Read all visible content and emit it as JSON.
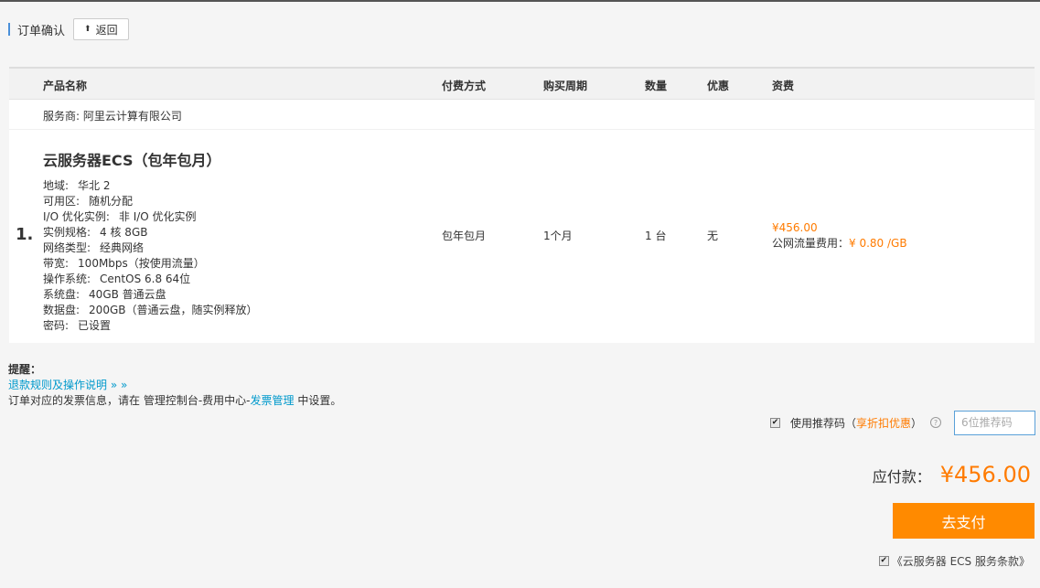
{
  "header": {
    "title": "订单确认",
    "back_label": "返回"
  },
  "table": {
    "columns": [
      "产品名称",
      "付费方式",
      "购买周期",
      "数量",
      "优惠",
      "资费"
    ],
    "vendor": "服务商: 阿里云计算有限公司",
    "item": {
      "index": "1.",
      "name": "云服务器ECS（包年包月）",
      "specs": [
        {
          "label": "地域:",
          "value": "华北 2"
        },
        {
          "label": "可用区:",
          "value": "随机分配"
        },
        {
          "label": "I/O 优化实例:",
          "value": "非 I/O 优化实例"
        },
        {
          "label": "实例规格:",
          "value": "4 核 8GB"
        },
        {
          "label": "网络类型:",
          "value": "经典网络"
        },
        {
          "label": "带宽:",
          "value": "100Mbps（按使用流量）"
        },
        {
          "label": "操作系统:",
          "value": "CentOS 6.8 64位"
        },
        {
          "label": "系统盘:",
          "value": "40GB 普通云盘"
        },
        {
          "label": "数据盘:",
          "value": "200GB（普通云盘，随实例释放）"
        },
        {
          "label": "密码:",
          "value": "已设置"
        }
      ],
      "payment_type": "包年包月",
      "period": "1个月",
      "quantity": "1 台",
      "discount": "无",
      "price": "¥456.00",
      "traffic_fee_label": "公网流量费用：",
      "traffic_fee_value": "¥ 0.80 /GB"
    }
  },
  "notes": {
    "title": "提醒：",
    "refund_link": "退款规则及操作说明",
    "refund_link_suffix": "» »",
    "invoice_prefix": "订单对应的发票信息，请在 管理控制台-费用中心-",
    "invoice_link": "发票管理",
    "invoice_suffix": " 中设置。"
  },
  "promo": {
    "label": "使用推荐码（",
    "link": "享折扣优惠",
    "label_end": "）",
    "placeholder": "6位推荐码"
  },
  "total": {
    "label": "应付款：",
    "amount": "¥456.00"
  },
  "pay_button": "去支付",
  "terms": "《云服务器 ECS 服务条款》",
  "colors": {
    "accent": "#ff8a00",
    "link": "#0099cc",
    "price": "#ff7b00"
  }
}
